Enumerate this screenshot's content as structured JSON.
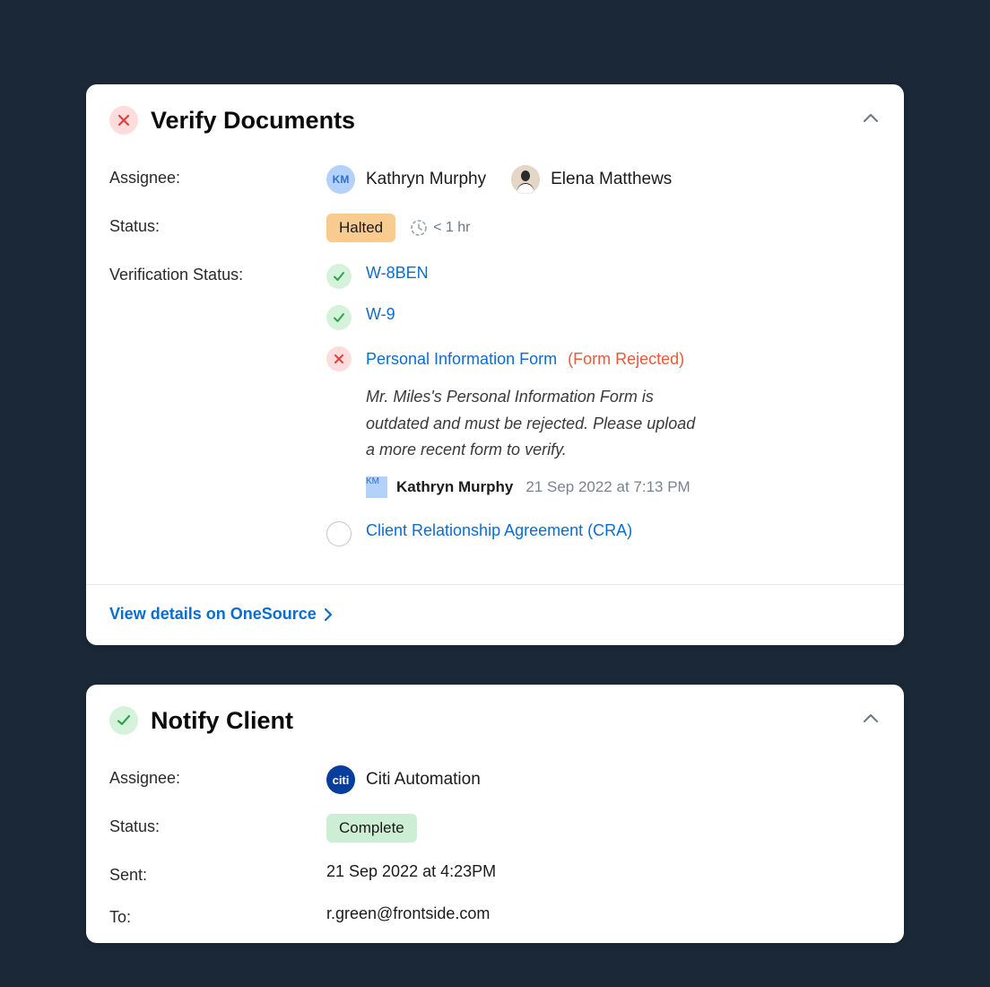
{
  "card1": {
    "title": "Verify Documents",
    "labels": {
      "assignee": "Assignee:",
      "status": "Status:",
      "verification": "Verification Status:"
    },
    "assignees": [
      {
        "initials": "KM",
        "name": "Kathryn Murphy"
      },
      {
        "initials": "",
        "name": "Elena Matthews"
      }
    ],
    "status": "Halted",
    "time": "< 1 hr",
    "verifications": [
      {
        "state": "ok",
        "label": "W-8BEN"
      },
      {
        "state": "ok",
        "label": "W-9"
      },
      {
        "state": "err",
        "label": "Personal Information Form",
        "rej_text": "(Form Rejected)",
        "note": "Mr. Miles's Personal Information Form is outdated and must be rejected. Please upload a more recent form to verify.",
        "note_author": "Kathryn Murphy",
        "note_author_initials": "KM",
        "note_date": "21 Sep 2022 at 7:13 PM"
      },
      {
        "state": "empty",
        "label": "Client Relationship Agreement (CRA)"
      }
    ],
    "footer_link": "View details on OneSource"
  },
  "card2": {
    "title": "Notify Client",
    "labels": {
      "assignee": "Assignee:",
      "status": "Status:",
      "sent": "Sent:",
      "to": "To:"
    },
    "assignee": {
      "label": "citi",
      "name": "Citi Automation"
    },
    "status": "Complete",
    "sent": "21 Sep 2022 at 4:23PM",
    "to": "r.green@frontside.com"
  }
}
